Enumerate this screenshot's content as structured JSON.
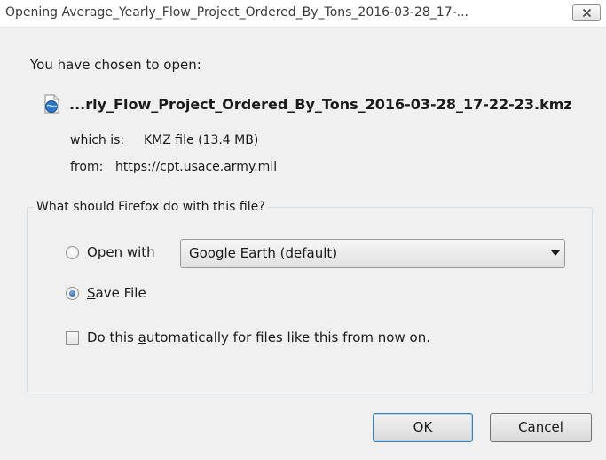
{
  "window": {
    "title": "Opening Average_Yearly_Flow_Project_Ordered_By_Tons_2016-03-28_17-..."
  },
  "dialog": {
    "intro": "You have chosen to open:",
    "file_name": "...rly_Flow_Project_Ordered_By_Tons_2016-03-28_17-22-23.kmz",
    "type_label": "which is:",
    "type_value": "KMZ file (13.4 MB)",
    "from_label": "from:",
    "from_value": "https://cpt.usace.army.mil",
    "question": "What should Firefox do with this file?",
    "open_with": {
      "mnemonic": "O",
      "label_rest": "pen with",
      "selected": false,
      "app": "Google Earth (default)"
    },
    "save_file": {
      "mnemonic": "S",
      "label_rest": "ave File",
      "selected": true
    },
    "auto": {
      "label_before": "Do this ",
      "mnemonic": "a",
      "label_after": "utomatically for files like this from now on.",
      "checked": false
    },
    "ok_label": "OK",
    "cancel_label": "Cancel"
  }
}
